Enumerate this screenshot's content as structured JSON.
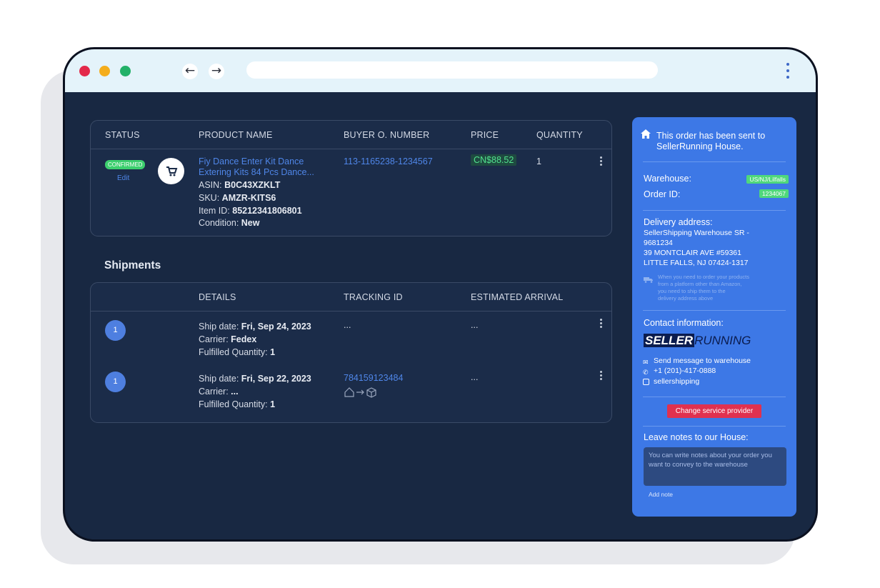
{
  "orders": {
    "headers": [
      "STATUS",
      "PRODUCT NAME",
      "BUYER O. NUMBER",
      "PRICE",
      "QUANTITY"
    ],
    "row": {
      "status_badge": "CONFIRMED",
      "edit_label": "Edit",
      "product_name_line1": "Fiy Dance Enter Kit Dance",
      "product_name_line2": "Extering Kits 84 Pcs Dance...",
      "asin_label": "ASIN:",
      "asin_value": "B0C43XZKLT",
      "sku_label": "SKU:",
      "sku_value": "AMZR-KITS6",
      "item_id_label": "Item ID:",
      "item_id_value": "85212341806801",
      "condition_label": "Condition:",
      "condition_value": "New",
      "buyer_order_number": "113-1165238-1234567",
      "price": "CN$88.52",
      "quantity": "1"
    }
  },
  "shipments": {
    "title": "Shipments",
    "headers": [
      "DETAILS",
      "TRACKING ID",
      "ESTIMATED ARRIVAL"
    ],
    "rows": [
      {
        "number": "1",
        "ship_date_label": "Ship date:",
        "ship_date": "Fri, Sep 24, 2023",
        "carrier_label": "Carrier:",
        "carrier": "Fedex",
        "fulfilled_label": "Fulfilled Quantity:",
        "fulfilled": "1",
        "tracking_id": "...",
        "estimated_arrival": "..."
      },
      {
        "number": "1",
        "ship_date_label": "Ship date:",
        "ship_date": "Fri, Sep 22, 2023",
        "carrier_label": "Carrier:",
        "carrier": "...",
        "fulfilled_label": "Fulfilled Quantity:",
        "fulfilled": "1",
        "tracking_id": "784159123484",
        "estimated_arrival": "..."
      }
    ]
  },
  "sidebar": {
    "sent_line1": "This order has been sent to",
    "sent_line2": "SellerRunning House.",
    "warehouse_label": "Warehouse:",
    "warehouse_value": "US/NJ/Lilfalls",
    "order_id_label": "Order ID:",
    "order_id_value": "1234067",
    "delivery_title": "Delivery address:",
    "address_line1": "SellerShipping Warehouse SR -",
    "address_line2": "9681234",
    "address_line3": "39 MONTCLAIR AVE #59361",
    "address_line4": "LITTLE FALLS, NJ 07424-1317",
    "note_line1": "When you need to order your products",
    "note_line2": "from a platform other than Amazon,",
    "note_line3": "you need to ship them to the",
    "note_line4": "delivery address above",
    "contact_title": "Contact information:",
    "logo_part1": "SELLER",
    "logo_part2": "RUNNING",
    "contact_message": "Send message to warehouse",
    "contact_phone": "+1 (201)-417-0888",
    "contact_instagram": "sellershipping",
    "change_provider": "Change service provider",
    "notes_title": "Leave notes to our House:",
    "notes_placeholder": "You can write notes about your order you want to convey to the warehouse",
    "add_note": "Add note"
  },
  "colors": {
    "window_bg": "#182842",
    "titlebar_bg": "#e4f3fa",
    "sidebar_bg": "#3d78e6",
    "accent_link": "#4f86e8",
    "confirmed_green": "#3ccf6e",
    "danger_red": "#e0314f"
  }
}
